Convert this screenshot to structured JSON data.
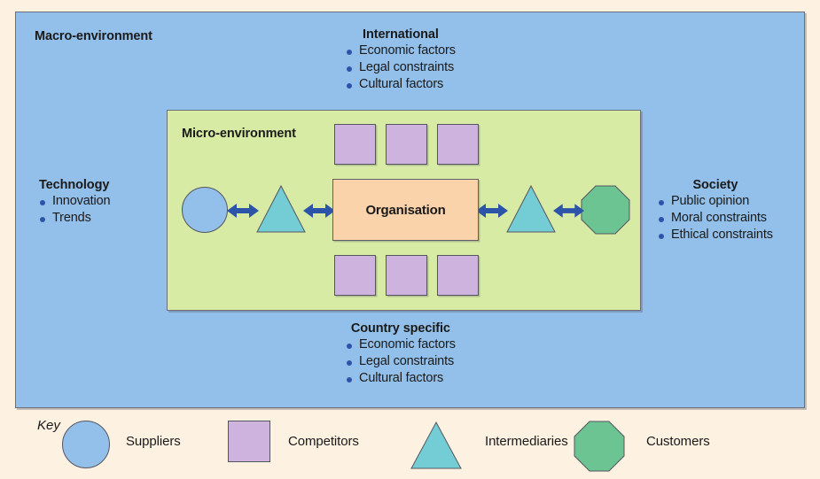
{
  "diagram": {
    "macro": {
      "title": "Macro-environment",
      "fill": "#93c0ea"
    },
    "micro": {
      "title": "Micro-environment",
      "fill": "#d7eba5"
    },
    "organisation": {
      "label": "Organisation",
      "fill": "#fad3ab"
    },
    "bullet_groups": [
      {
        "id": "international",
        "title": "International",
        "items": [
          "Economic factors",
          "Legal constraints",
          "Cultural factors"
        ]
      },
      {
        "id": "technology",
        "title": "Technology",
        "items": [
          "Innovation",
          "Trends"
        ]
      },
      {
        "id": "society",
        "title": "Society",
        "items": [
          "Public opinion",
          "Moral constraints",
          "Ethical constraints"
        ]
      },
      {
        "id": "country-specific",
        "title": "Country specific",
        "items": [
          "Economic factors",
          "Legal constraints",
          "Cultural factors"
        ]
      }
    ],
    "shapes": {
      "suppliers": {
        "name": "circle",
        "fill": "#93c0ea"
      },
      "competitors": {
        "name": "square",
        "fill": "#cfb3df"
      },
      "intermediaries": {
        "name": "triangle",
        "fill": "#74cdd4"
      },
      "customers": {
        "name": "octagon",
        "fill": "#6cc492"
      }
    },
    "arrows": {
      "name": "double-headed-arrow",
      "color": "#2c54a8",
      "count": 4
    },
    "bullet_color": "#2c54a8",
    "page_background": "#fdf2e2"
  },
  "key": {
    "title": "Key",
    "entries": [
      {
        "shape": "circle",
        "label": "Suppliers"
      },
      {
        "shape": "square",
        "label": "Competitors"
      },
      {
        "shape": "triangle",
        "label": "Intermediaries"
      },
      {
        "shape": "octagon",
        "label": "Customers"
      }
    ]
  }
}
